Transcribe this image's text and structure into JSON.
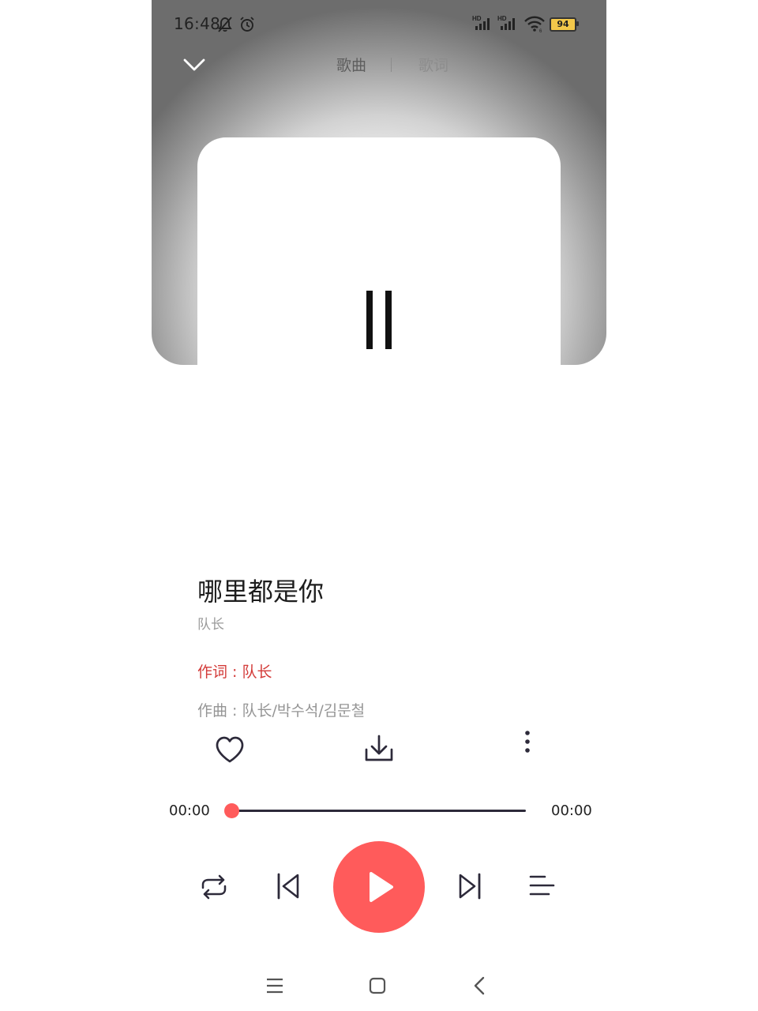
{
  "status_bar": {
    "time": "16:48",
    "battery": "94",
    "icons": [
      "mute-bell-icon",
      "alarm-icon",
      "hd-signal-icon",
      "hd-signal-icon",
      "wifi-icon",
      "battery-icon"
    ]
  },
  "header": {
    "tabs": [
      {
        "label": "歌曲",
        "active": true
      },
      {
        "label": "歌词",
        "active": false
      }
    ]
  },
  "song": {
    "title": "哪里都是你",
    "artist": "队长",
    "lyricist": "作词 : 队长",
    "composer": "作曲 : 队长/박수석/김문철"
  },
  "actions": [
    "heart-icon",
    "download-icon",
    "more-vertical-icon"
  ],
  "progress": {
    "current": "00:00",
    "total": "00:00",
    "fraction": 0.0
  },
  "controls": [
    "repeat-icon",
    "previous-icon",
    "play-icon",
    "next-icon",
    "playlist-icon"
  ],
  "colors": {
    "accent": "#ff5b5b",
    "lyricist_text": "#d33a38",
    "dark": "#2d2a3a"
  },
  "nav": [
    "menu-icon",
    "home-icon",
    "back-icon"
  ]
}
